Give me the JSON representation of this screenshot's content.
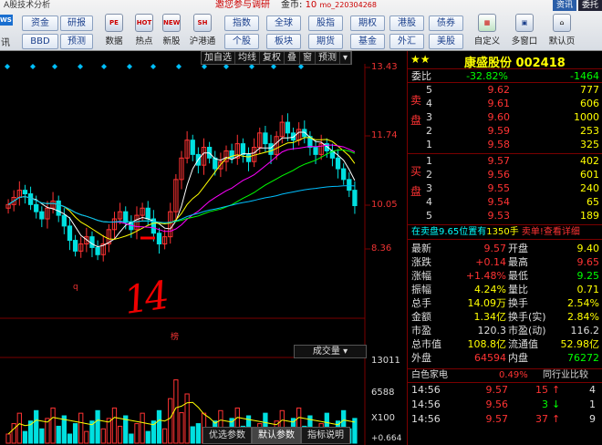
{
  "window": {
    "title": "A股技术分析"
  },
  "header": {
    "invite": "邀您参与调研",
    "coins_label": "金币:",
    "coins_value": "10",
    "user": "mo_220304268",
    "right_buttons": [
      "资讯",
      "委托"
    ]
  },
  "toolbar": {
    "logo_text": "WS",
    "logo_caption": "讯",
    "row1": [
      "资金",
      "研报",
      "指数",
      "全球",
      "股指",
      "期权",
      "港股",
      "债券"
    ],
    "row2": [
      "BBD",
      "预测",
      "个股",
      "板块",
      "期货",
      "基金",
      "外汇",
      "美股"
    ],
    "icons": [
      {
        "label": "数据",
        "glyph": "PE",
        "icon": "data-icon"
      },
      {
        "label": "热点",
        "glyph": "HOT",
        "icon": "hot-icon"
      },
      {
        "label": "新股",
        "glyph": "NEW",
        "icon": "ipo-icon"
      },
      {
        "label": "沪港通",
        "glyph": "SH",
        "icon": "hk-connect-icon"
      },
      {
        "label": "自定义",
        "glyph": "",
        "icon": "custom-icon"
      },
      {
        "label": "多窗口",
        "glyph": "",
        "icon": "multi-window-icon"
      },
      {
        "label": "默认页",
        "glyph": "",
        "icon": "default-page-icon"
      }
    ]
  },
  "chart": {
    "toolbar": [
      "加自选",
      "均线",
      "复权",
      "叠",
      "窗",
      "预测",
      "▾"
    ],
    "price_labels": [
      "13.43",
      "11.74",
      "10.05",
      "8.36"
    ],
    "volume_labels": [
      "13011",
      "6588",
      "X100"
    ],
    "volume_selector": "成交量 ▾",
    "markers": {
      "q": "q",
      "bang": "榜"
    },
    "annotation": "14",
    "bottom_tabs": [
      "优选参数",
      "默认参数",
      "指标说明"
    ],
    "corner_value": "+0.664",
    "colors": {
      "up": "#ff3333",
      "down": "#00e0e0",
      "ma5": "#ffffff",
      "ma10": "#ffff00",
      "ma20": "#ff00ff",
      "ma30": "#00ff00",
      "ma60": "#00bfff"
    }
  },
  "quote": {
    "stars": "★★",
    "name": "康盛股份",
    "code": "002418",
    "weibi_label": "委比",
    "weibi_pct": "-32.82%",
    "weibi_diff": "-1464",
    "sell_label": "卖盘",
    "buy_label": "买盘",
    "sell": [
      {
        "lvl": "5",
        "price": "9.62",
        "vol": "777"
      },
      {
        "lvl": "4",
        "price": "9.61",
        "vol": "606"
      },
      {
        "lvl": "3",
        "price": "9.60",
        "vol": "1000"
      },
      {
        "lvl": "2",
        "price": "9.59",
        "vol": "253"
      },
      {
        "lvl": "1",
        "price": "9.58",
        "vol": "325"
      }
    ],
    "buy": [
      {
        "lvl": "1",
        "price": "9.57",
        "vol": "402"
      },
      {
        "lvl": "2",
        "price": "9.56",
        "vol": "601"
      },
      {
        "lvl": "3",
        "price": "9.55",
        "vol": "240"
      },
      {
        "lvl": "4",
        "price": "9.54",
        "vol": "65"
      },
      {
        "lvl": "5",
        "price": "9.53",
        "vol": "189"
      }
    ],
    "message": {
      "a": "在卖盘9.65位置有",
      "b": "1350手",
      "c": "卖单!查看详细"
    },
    "stats": [
      {
        "l1": "最新",
        "v1": "9.57",
        "c1": "red",
        "l2": "开盘",
        "v2": "9.40",
        "c2": "yel"
      },
      {
        "l1": "涨跌",
        "v1": "+0.14",
        "c1": "red",
        "l2": "最高",
        "v2": "9.65",
        "c2": "red"
      },
      {
        "l1": "涨幅",
        "v1": "+1.48%",
        "c1": "red",
        "l2": "最低",
        "v2": "9.25",
        "c2": "grn"
      },
      {
        "l1": "振幅",
        "v1": "4.24%",
        "c1": "yel",
        "l2": "量比",
        "v2": "0.71",
        "c2": "yel"
      },
      {
        "l1": "总手",
        "v1": "14.09万",
        "c1": "yel",
        "l2": "换手",
        "v2": "2.54%",
        "c2": "yel"
      },
      {
        "l1": "金额",
        "v1": "1.34亿",
        "c1": "yel",
        "l2": "换手(实)",
        "v2": "2.84%",
        "c2": "yel"
      },
      {
        "l1": "市盈",
        "v1": "120.3",
        "c1": "wht",
        "l2": "市盈(动)",
        "v2": "116.2",
        "c2": "wht"
      },
      {
        "l1": "总市值",
        "v1": "108.8亿",
        "c1": "yel",
        "l2": "流通值",
        "v2": "52.98亿",
        "c2": "yel"
      },
      {
        "l1": "外盘",
        "v1": "64594",
        "c1": "red",
        "l2": "内盘",
        "v2": "76272",
        "c2": "grn"
      }
    ],
    "sector": {
      "name": "白色家电",
      "pct": "0.49%",
      "compare": "同行业比较"
    },
    "ticks": [
      {
        "time": "14:56",
        "price": "9.57",
        "vol": "15",
        "dir": "↑",
        "cnt": "4"
      },
      {
        "time": "14:56",
        "price": "9.56",
        "vol": "3",
        "dir": "↓",
        "cnt": "1"
      },
      {
        "time": "14:56",
        "price": "9.57",
        "vol": "37",
        "dir": "↑",
        "cnt": "9"
      }
    ]
  }
}
